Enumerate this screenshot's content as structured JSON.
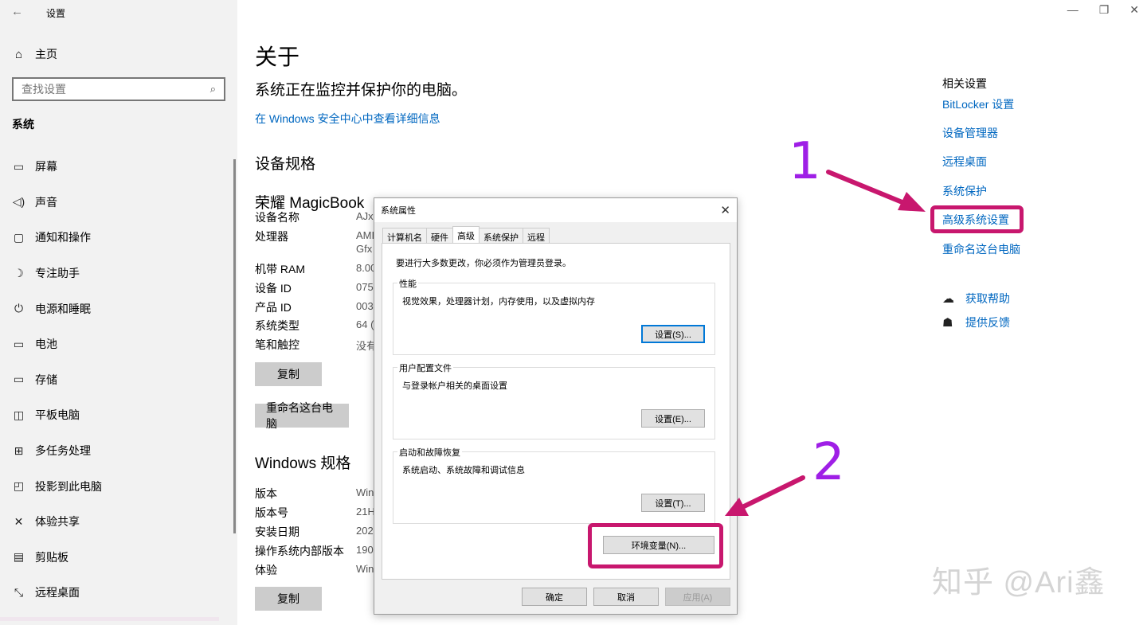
{
  "window": {
    "title": "设置",
    "back_icon": "back-arrow-icon",
    "minimize": "—",
    "maximize": "❐",
    "close": "✕"
  },
  "sidebar": {
    "home": "主页",
    "search_placeholder": "查找设置",
    "section": "系统",
    "items": [
      {
        "label": "屏幕",
        "icon": "monitor-icon",
        "glyph": "▭"
      },
      {
        "label": "声音",
        "icon": "speaker-icon",
        "glyph": "🔊"
      },
      {
        "label": "通知和操作",
        "icon": "notification-icon",
        "glyph": "▢"
      },
      {
        "label": "专注助手",
        "icon": "moon-icon",
        "glyph": "☽"
      },
      {
        "label": "电源和睡眠",
        "icon": "power-icon",
        "glyph": "⏻"
      },
      {
        "label": "电池",
        "icon": "battery-icon",
        "glyph": "▭"
      },
      {
        "label": "存储",
        "icon": "storage-icon",
        "glyph": "▭"
      },
      {
        "label": "平板电脑",
        "icon": "tablet-icon",
        "glyph": "◫"
      },
      {
        "label": "多任务处理",
        "icon": "multitask-icon",
        "glyph": "⊞"
      },
      {
        "label": "投影到此电脑",
        "icon": "project-icon",
        "glyph": "◰"
      },
      {
        "label": "体验共享",
        "icon": "share-icon",
        "glyph": "✕"
      },
      {
        "label": "剪贴板",
        "icon": "clipboard-icon",
        "glyph": "📋"
      },
      {
        "label": "远程桌面",
        "icon": "remote-desktop-icon",
        "glyph": "⤡"
      }
    ]
  },
  "main": {
    "title": "关于",
    "status": "系统正在监控并保护你的电脑。",
    "security_link": "在 Windows 安全中心中查看详细信息",
    "device_specs_title": "设备规格",
    "device_name": "荣耀 MagicBook",
    "device_specs": [
      {
        "label": "设备名称",
        "value": "AJx"
      },
      {
        "label": "处理器",
        "value": "AMI"
      },
      {
        "label": "",
        "value": "Gfx"
      },
      {
        "label": "机带 RAM",
        "value": "8.00"
      },
      {
        "label": "设备 ID",
        "value": "075("
      },
      {
        "label": "产品 ID",
        "value": "003-"
      },
      {
        "label": "系统类型",
        "value": "64 (("
      },
      {
        "label": "笔和触控",
        "value": "没有"
      }
    ],
    "copy_button": "复制",
    "rename_button": "重命名这台电脑",
    "windows_specs_title": "Windows 规格",
    "windows_specs": [
      {
        "label": "版本",
        "value": "Win"
      },
      {
        "label": "版本号",
        "value": "21H"
      },
      {
        "label": "安装日期",
        "value": "202"
      },
      {
        "label": "操作系统内部版本",
        "value": "1904"
      },
      {
        "label": "体验",
        "value": "Win"
      }
    ],
    "copy_button_2": "复制"
  },
  "related": {
    "title": "相关设置",
    "links": [
      "BitLocker 设置",
      "设备管理器",
      "远程桌面",
      "系统保护",
      "高级系统设置",
      "重命名这台电脑"
    ],
    "help": "获取帮助",
    "feedback": "提供反馈"
  },
  "dialog": {
    "title": "系统属性",
    "tabs": [
      "计算机名",
      "硬件",
      "高级",
      "系统保护",
      "远程"
    ],
    "active_tab": "高级",
    "admin_note": "要进行大多数更改，你必须作为管理员登录。",
    "groups": [
      {
        "title": "性能",
        "desc": "视觉效果，处理器计划，内存使用，以及虚拟内存",
        "button": "设置(S)..."
      },
      {
        "title": "用户配置文件",
        "desc": "与登录帐户相关的桌面设置",
        "button": "设置(E)..."
      },
      {
        "title": "启动和故障恢复",
        "desc": "系统启动、系统故障和调试信息",
        "button": "设置(T)..."
      }
    ],
    "env_button": "环境变量(N)...",
    "ok": "确定",
    "cancel": "取消",
    "apply": "应用(A)"
  },
  "annotations": {
    "step1": "1",
    "step2": "2",
    "highlight_color": "#c8176e",
    "number_color": "#9f1fe6"
  },
  "watermark": "知乎 @Ari鑫"
}
